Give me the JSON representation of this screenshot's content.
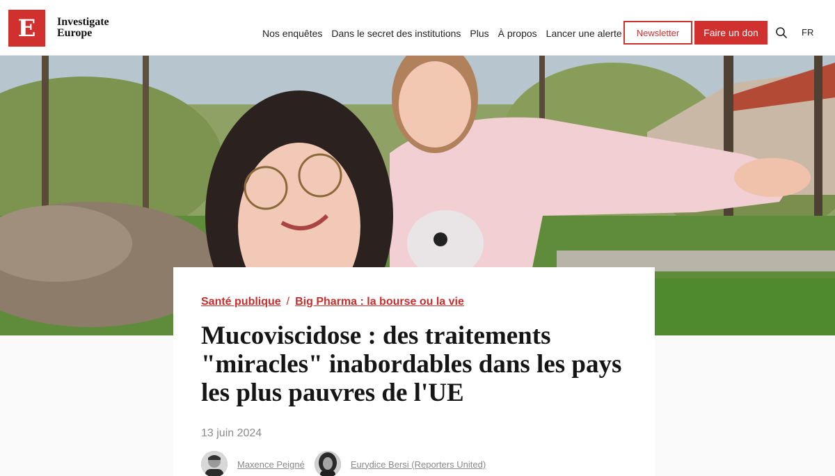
{
  "header": {
    "logo_letter": "E",
    "logo_line1": "Investigate",
    "logo_line2": "Europe",
    "nav": [
      {
        "label": "Nos enquêtes"
      },
      {
        "label": "Dans le secret des institutions"
      },
      {
        "label": "Plus"
      },
      {
        "label": "À propos"
      },
      {
        "label": "Lancer une alerte"
      }
    ],
    "newsletter_label": "Newsletter",
    "donate_label": "Faire un don",
    "language": "FR"
  },
  "article": {
    "category": "Santé publique",
    "separator": "/",
    "series": "Big Pharma : la bourse ou la vie",
    "title": "Mucoviscidose : des traitements \"miracles\" inabordables dans les pays les plus pauvres de l'UE",
    "date": "13 juin 2024",
    "authors": [
      {
        "name": "Maxence Peigné"
      },
      {
        "name": "Eurydice Bersi (Reporters United)"
      }
    ]
  },
  "colors": {
    "brand_red": "#d1312e"
  },
  "icons": {
    "search": "search-icon"
  }
}
